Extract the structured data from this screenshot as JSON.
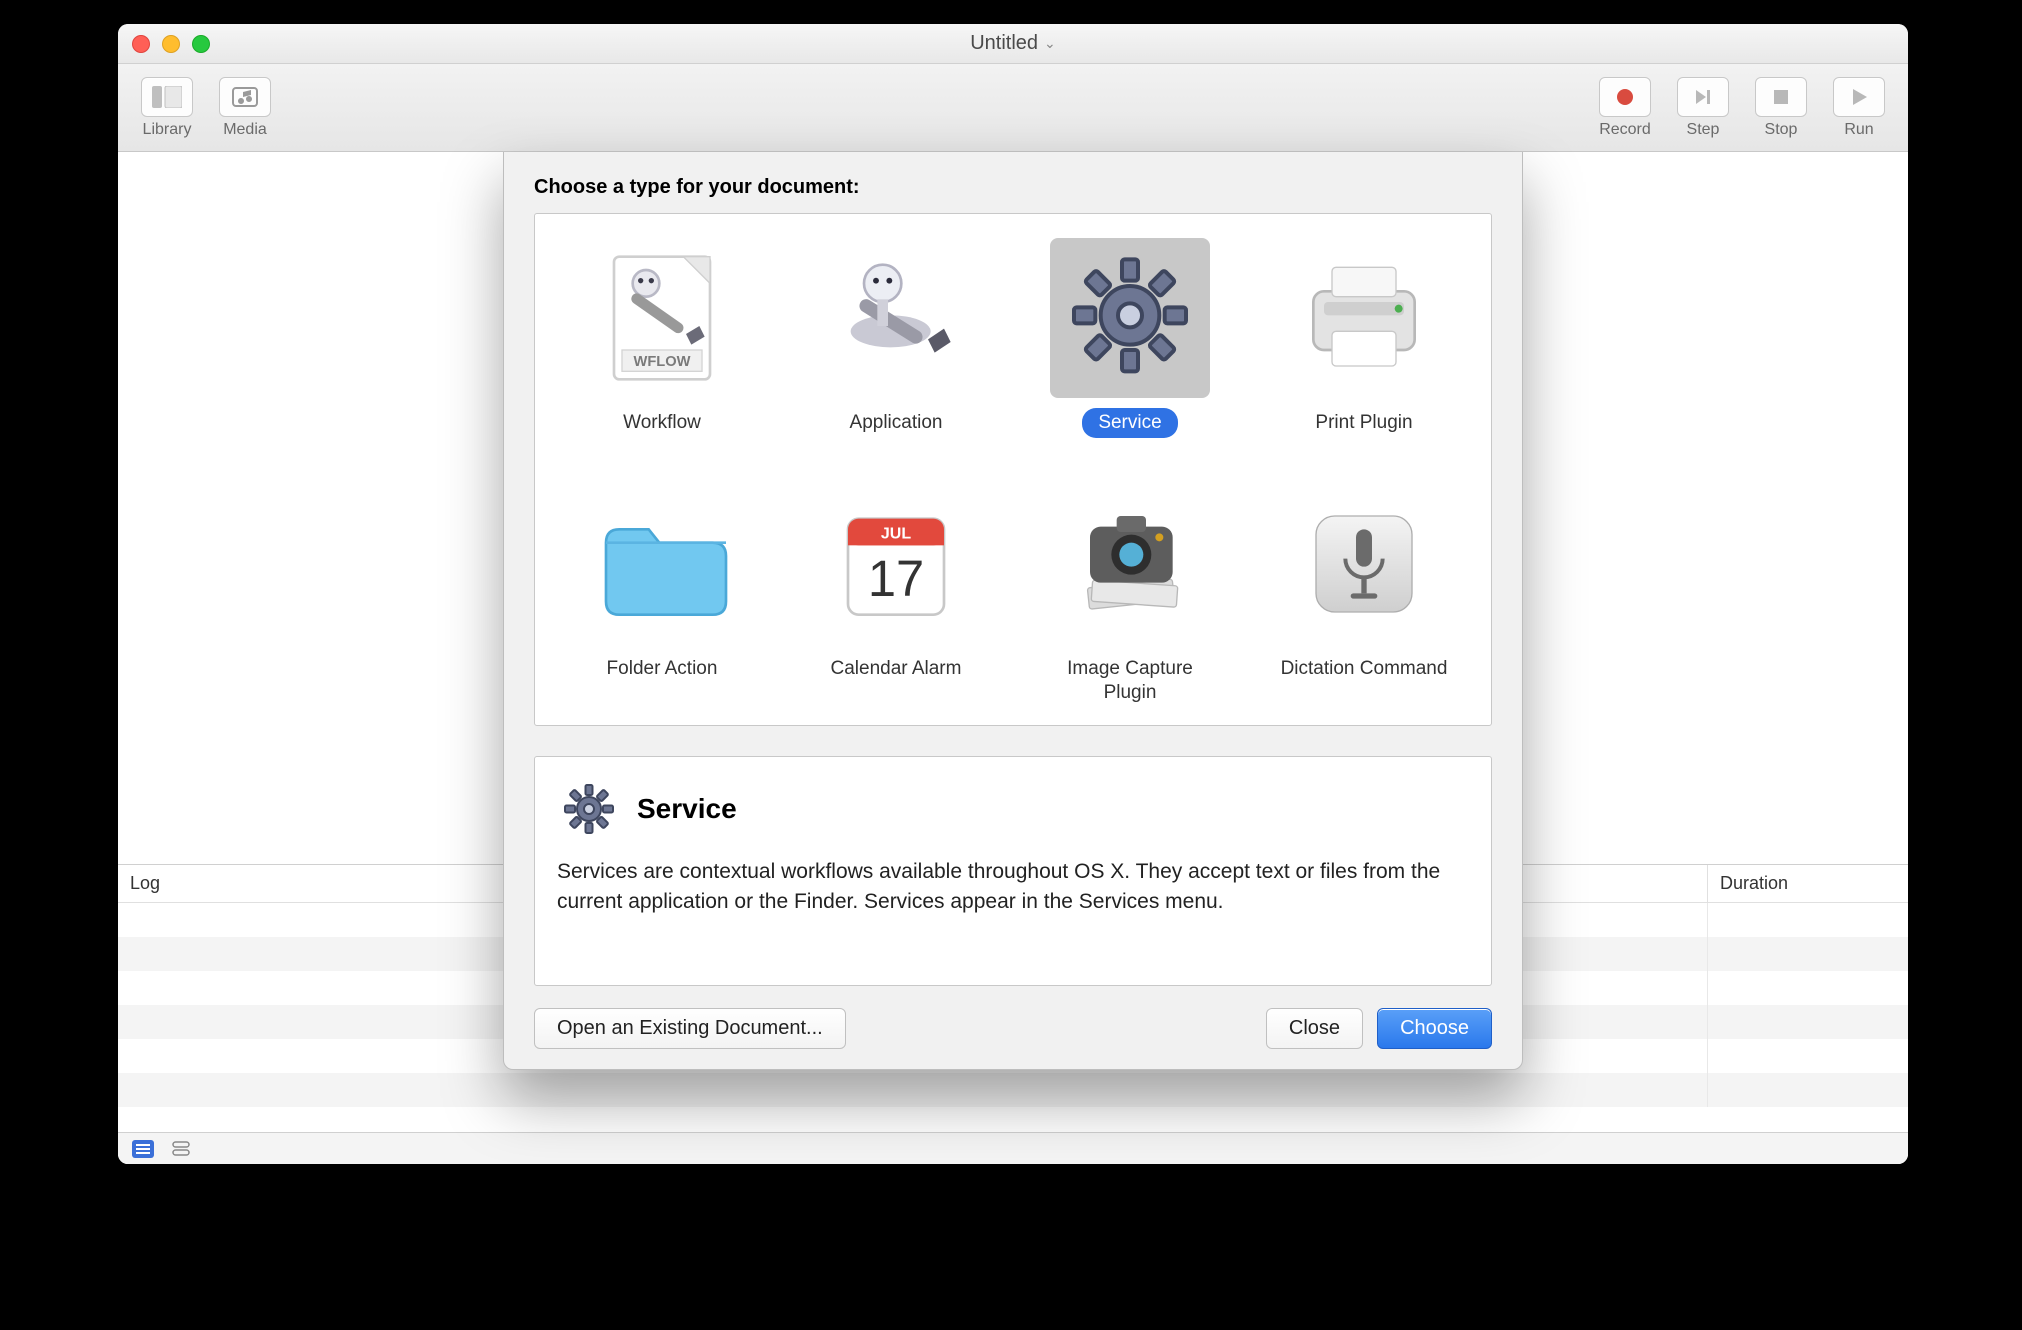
{
  "window": {
    "title": "Untitled"
  },
  "toolbar": {
    "left": [
      {
        "label": "Library"
      },
      {
        "label": "Media"
      }
    ],
    "right": [
      {
        "label": "Record"
      },
      {
        "label": "Step"
      },
      {
        "label": "Stop"
      },
      {
        "label": "Run"
      }
    ]
  },
  "log": {
    "columns": {
      "log": "Log",
      "duration": "Duration"
    }
  },
  "sheet": {
    "heading": "Choose a type for your document:",
    "types": [
      {
        "label": "Workflow",
        "icon": "workflow-icon",
        "selected": false
      },
      {
        "label": "Application",
        "icon": "application-icon",
        "selected": false
      },
      {
        "label": "Service",
        "icon": "service-icon",
        "selected": true
      },
      {
        "label": "Print Plugin",
        "icon": "print-plugin-icon",
        "selected": false
      },
      {
        "label": "Folder Action",
        "icon": "folder-action-icon",
        "selected": false
      },
      {
        "label": "Calendar Alarm",
        "icon": "calendar-alarm-icon",
        "selected": false
      },
      {
        "label": "Image Capture Plugin",
        "icon": "image-capture-plugin-icon",
        "selected": false
      },
      {
        "label": "Dictation Command",
        "icon": "dictation-command-icon",
        "selected": false
      }
    ],
    "description": {
      "title": "Service",
      "body": "Services are contextual workflows available throughout OS X. They accept text or files from the current application or the Finder. Services appear in the Services menu."
    },
    "buttons": {
      "open": "Open an Existing Document...",
      "close": "Close",
      "choose": "Choose"
    }
  },
  "icons": {
    "workflow_badge": "WFLOW",
    "calendar_month": "JUL",
    "calendar_day": "17"
  }
}
